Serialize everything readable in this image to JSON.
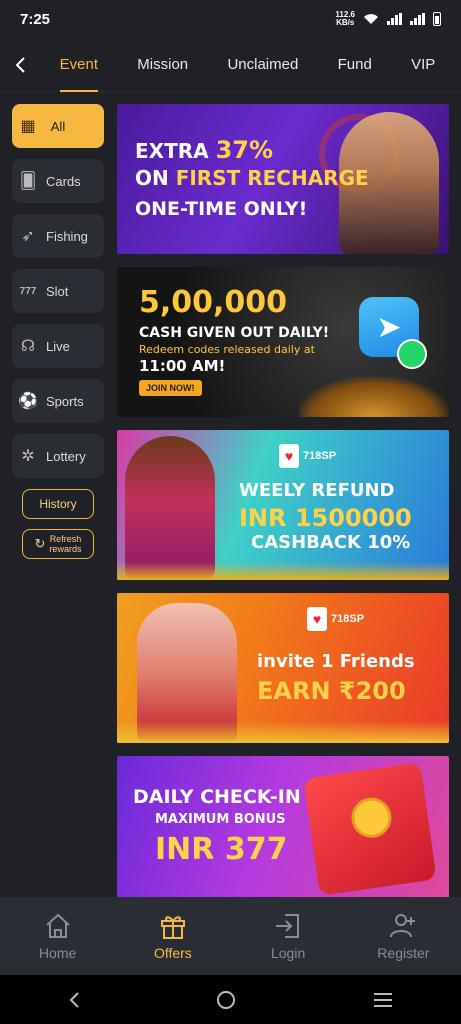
{
  "status_bar": {
    "time": "7:25",
    "speed_value": "112.6",
    "speed_unit": "KB/s"
  },
  "tabs": [
    {
      "label": "Event",
      "active": true
    },
    {
      "label": "Mission"
    },
    {
      "label": "Unclaimed"
    },
    {
      "label": "Fund"
    },
    {
      "label": "VIP"
    }
  ],
  "sidebar": {
    "categories": [
      {
        "label": "All",
        "icon": "grid-icon",
        "active": true
      },
      {
        "label": "Cards",
        "icon": "cards-icon"
      },
      {
        "label": "Fishing",
        "icon": "fish-icon"
      },
      {
        "label": "Slot",
        "icon": "slot-icon"
      },
      {
        "label": "Live",
        "icon": "live-icon"
      },
      {
        "label": "Sports",
        "icon": "soccer-ball-icon"
      },
      {
        "label": "Lottery",
        "icon": "lottery-icon"
      }
    ],
    "history_label": "History",
    "refresh_label_1": "Refresh",
    "refresh_label_2": "rewards"
  },
  "banners": {
    "recharge": {
      "line1_a": "EXTRA ",
      "line1_b": "37%",
      "line2_a": "ON ",
      "line2_b": "FIRST RECHARGE",
      "line3": "ONE-TIME ONLY!"
    },
    "telegram": {
      "amount": "5,00,000",
      "line1": "CASH GIVEN OUT DAILY!",
      "line2": "Redeem codes released daily at",
      "line3": "11:00 AM!",
      "button": "JOIN NOW!"
    },
    "refund": {
      "logo": "718SP",
      "line1": "WEELY REFUND",
      "line2": "INR 1500000",
      "line3": "CASHBACK 10%"
    },
    "invite": {
      "logo": "718SP",
      "line1": "invite 1 Friends",
      "line2": "EARN ₹200"
    },
    "checkin": {
      "line1": "DAILY CHECK-IN",
      "line2": "MAXIMUM BONUS",
      "line3": "INR 377"
    }
  },
  "bottom_nav": [
    {
      "label": "Home",
      "icon": "home-icon"
    },
    {
      "label": "Offers",
      "icon": "gift-icon",
      "active": true
    },
    {
      "label": "Login",
      "icon": "login-icon"
    },
    {
      "label": "Register",
      "icon": "add-user-icon"
    }
  ],
  "colors": {
    "accent": "#f5b942",
    "background": "#1f2126",
    "panel": "#2a2d33"
  }
}
